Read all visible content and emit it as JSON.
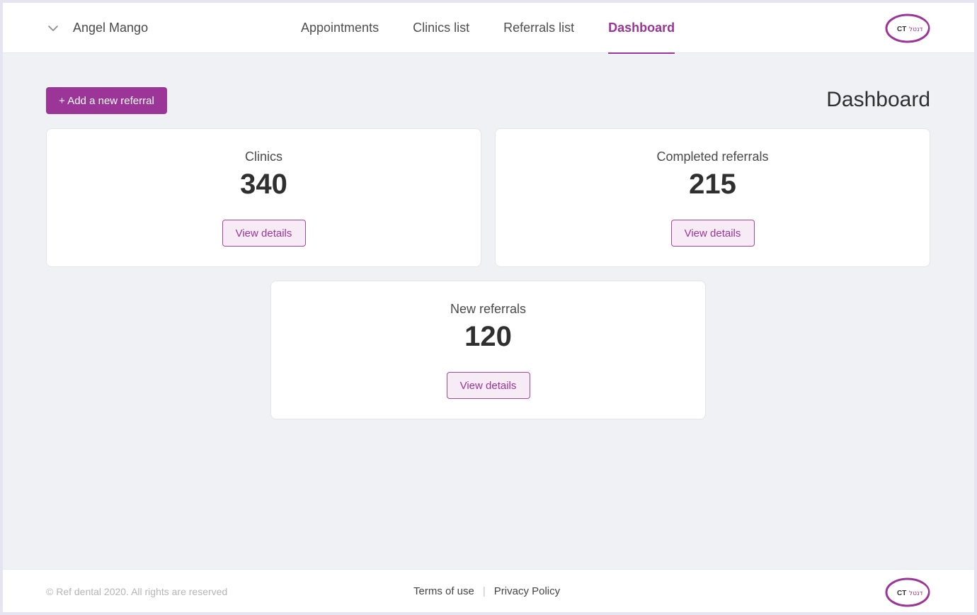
{
  "header": {
    "user_name": "Angel Mango",
    "nav": [
      {
        "label": "Appointments",
        "active": false
      },
      {
        "label": "Clinics list",
        "active": false
      },
      {
        "label": "Referrals list",
        "active": false
      },
      {
        "label": "Dashboard",
        "active": true
      }
    ],
    "logo_text": {
      "latin": "CT",
      "hebrew": "דנטל"
    }
  },
  "main": {
    "add_button_label": "+ Add a new referral",
    "page_title": "Dashboard",
    "cards": [
      {
        "label": "Clinics",
        "value": "340",
        "button": "View details"
      },
      {
        "label": "Completed referrals",
        "value": "215",
        "button": "View details"
      },
      {
        "label": "New referrals",
        "value": "120",
        "button": "View details"
      }
    ]
  },
  "footer": {
    "copyright": "© Ref dental 2020. All rights are reserved",
    "links": [
      "Terms of use",
      "Privacy Policy"
    ],
    "separator": "|"
  },
  "colors": {
    "accent": "#9b3597",
    "accent_light": "#f7ecf6",
    "background": "#eff1f5",
    "surface": "#ffffff"
  },
  "icons": {
    "user_menu": "chevron-down-icon",
    "logo": "brand-logo"
  }
}
